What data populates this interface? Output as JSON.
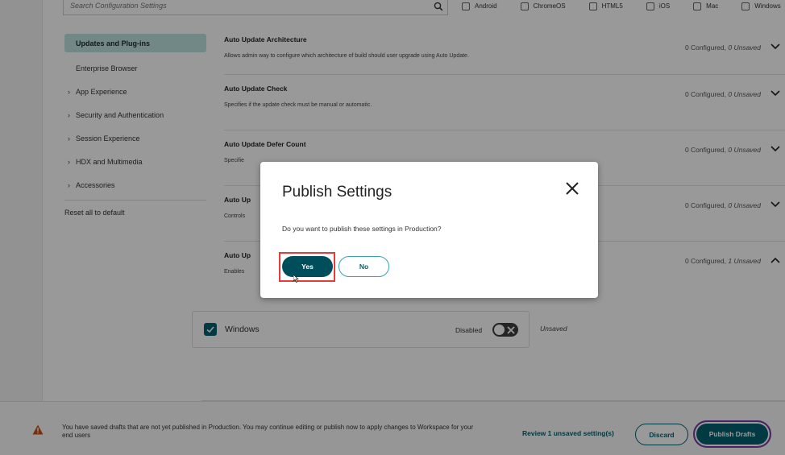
{
  "search": {
    "placeholder": "Search Configuration Settings"
  },
  "platform_filters": [
    {
      "label": "Android",
      "checked": false
    },
    {
      "label": "ChromeOS",
      "checked": false
    },
    {
      "label": "HTML5",
      "checked": false
    },
    {
      "label": "iOS",
      "checked": false
    },
    {
      "label": "Mac",
      "checked": false
    },
    {
      "label": "Windows",
      "checked": false
    }
  ],
  "sidebar": {
    "items": [
      {
        "label": "Updates and Plug-ins",
        "active": true,
        "expandable": false
      },
      {
        "label": "Enterprise Browser",
        "active": false,
        "expandable": false
      },
      {
        "label": "App Experience",
        "active": false,
        "expandable": true
      },
      {
        "label": "Security and Authentication",
        "active": false,
        "expandable": true
      },
      {
        "label": "Session Experience",
        "active": false,
        "expandable": true
      },
      {
        "label": "HDX and Multimedia",
        "active": false,
        "expandable": true
      },
      {
        "label": "Accessories",
        "active": false,
        "expandable": true
      }
    ],
    "reset_label": "Reset all to default",
    "chevron": "›"
  },
  "settings": [
    {
      "title": "Auto Update Architecture",
      "description": "Allows admin way to configure which architecture of build should user upgrade using Auto Update.",
      "configured": "0 Configured,",
      "unsaved": "0 Unsaved",
      "expanded": false
    },
    {
      "title": "Auto Update Check",
      "description": "Specifies if the update check must be manual or automatic.",
      "configured": "0 Configured,",
      "unsaved": "0 Unsaved",
      "expanded": false
    },
    {
      "title": "Auto Update Defer Count",
      "description": "Specifie",
      "configured": "0 Configured,",
      "unsaved": "0 Unsaved",
      "expanded": false
    },
    {
      "title": "Auto Up",
      "description": "Controls",
      "configured": "0 Configured,",
      "unsaved": "0 Unsaved",
      "expanded": false
    },
    {
      "title": "Auto Up",
      "description": "Enables",
      "configured": "0 Configured,",
      "unsaved": "1 Unsaved",
      "expanded": true
    }
  ],
  "platform_card": {
    "platform": "Windows",
    "checked": true,
    "state_label": "Disabled",
    "toggle_on": false,
    "status": "Unsaved"
  },
  "footer": {
    "message": "You have saved drafts that are not yet published in Production. You may continue editing or publish now to apply changes to Workspace for your end users",
    "review_link": "Review 1 unsaved setting(s)",
    "discard_label": "Discard",
    "publish_label": "Publish Drafts"
  },
  "modal": {
    "title": "Publish Settings",
    "message": "Do you want to publish these settings in Production?",
    "yes_label": "Yes",
    "no_label": "No"
  },
  "colors": {
    "brand_teal": "#02616e",
    "active_nav_bg": "#bfe3e2",
    "warning": "#c5501a",
    "highlight_box": "#e53b3b",
    "focus_ring": "#7d3aa8"
  }
}
